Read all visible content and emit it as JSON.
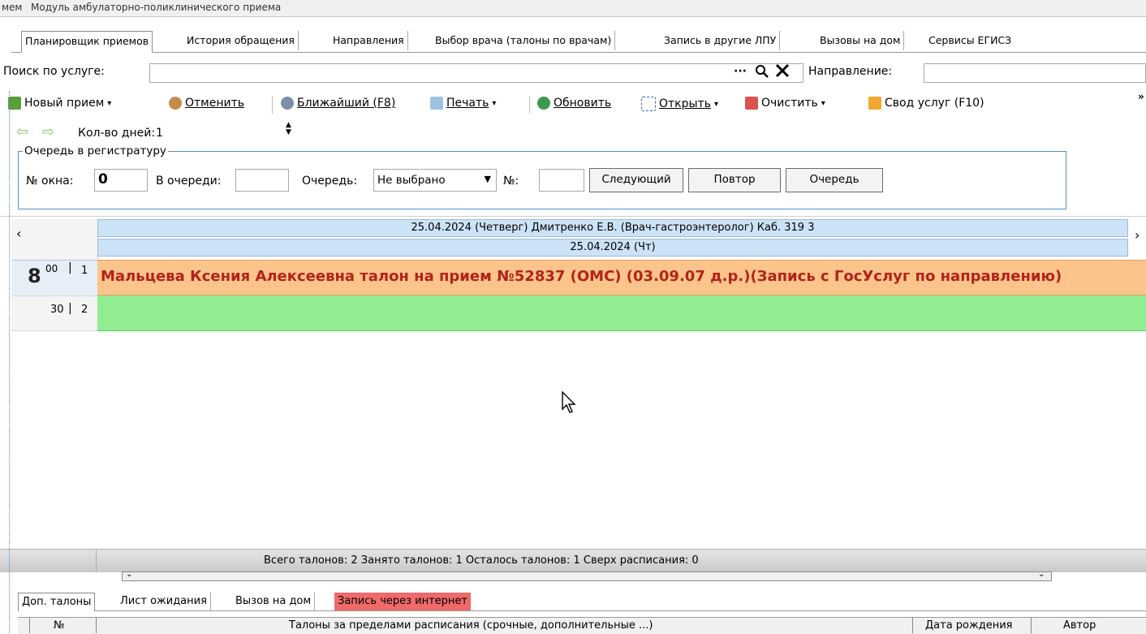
{
  "window": {
    "title_left": "мем",
    "title_module": "Модуль амбулаторно-поликлинического приема"
  },
  "tabs": [
    {
      "label": "Планировщик приемов"
    },
    {
      "label": "История обращения"
    },
    {
      "label": "Направления"
    },
    {
      "label": "Выбор врача (талоны по врачам)"
    },
    {
      "label": "Запись в другие ЛПУ"
    },
    {
      "label": "Вызовы на дом"
    },
    {
      "label": "Сервисы ЕГИСЗ"
    }
  ],
  "search": {
    "label": "Поиск по услуге:",
    "ellipsis": "···",
    "direction_label": "Направление:"
  },
  "toolbar": {
    "new_visit": "Новый прием",
    "cancel": "Отменить",
    "nearest": "Ближайший (F8)",
    "print": "Печать",
    "refresh": "Обновить",
    "open": "Открыть",
    "clear": "Очистить",
    "services": "Свод услуг (F10)"
  },
  "days": {
    "label": "Кол-во дней:",
    "value": "1"
  },
  "queue": {
    "group_title": "Очередь в регистратуру",
    "window_label": "№ окна:",
    "window_value": "0",
    "in_queue_label": "В очереди:",
    "queue_label": "Очередь:",
    "queue_value": "Не выбрано",
    "num_label": "№:",
    "next_btn": "Следующий",
    "repeat_btn": "Повтор",
    "queue_btn": "Очередь"
  },
  "schedule": {
    "header_doctor": "25.04.2024 (Четверг) Дмитренко Е.В. (Врач-гастроэнтеролог) Каб. 319 3",
    "header_date": "25.04.2024 (Чт)",
    "hour": "8",
    "slots": [
      {
        "minutes": "00",
        "num": "1",
        "text": "Мальцева Ксения Алексеевна талон на прием №52837 (ОМС) (03.09.07 д.р.)(Запись с ГосУслуг по направлению)"
      },
      {
        "minutes": "30",
        "num": "2",
        "text": ""
      }
    ]
  },
  "status": {
    "text": "Всего талонов: 2  Занято талонов: 1  Осталось талонов: 1  Сверх расписания: 0"
  },
  "bottom_tabs": [
    {
      "label": "Доп. талоны"
    },
    {
      "label": "Лист ожидания"
    },
    {
      "label": "Вызов на дом"
    },
    {
      "label": "Запись через интернет"
    }
  ],
  "grid_columns": {
    "num": "№",
    "tickets": "Талоны за пределами расписания (срочные, дополнительные ...)",
    "birth": "Дата рождения",
    "author": "Автор"
  },
  "colors": {
    "booked": "#fbc48a",
    "free": "#92ec92",
    "header": "#cce2f7",
    "internet_tab": "#f06a6a"
  }
}
